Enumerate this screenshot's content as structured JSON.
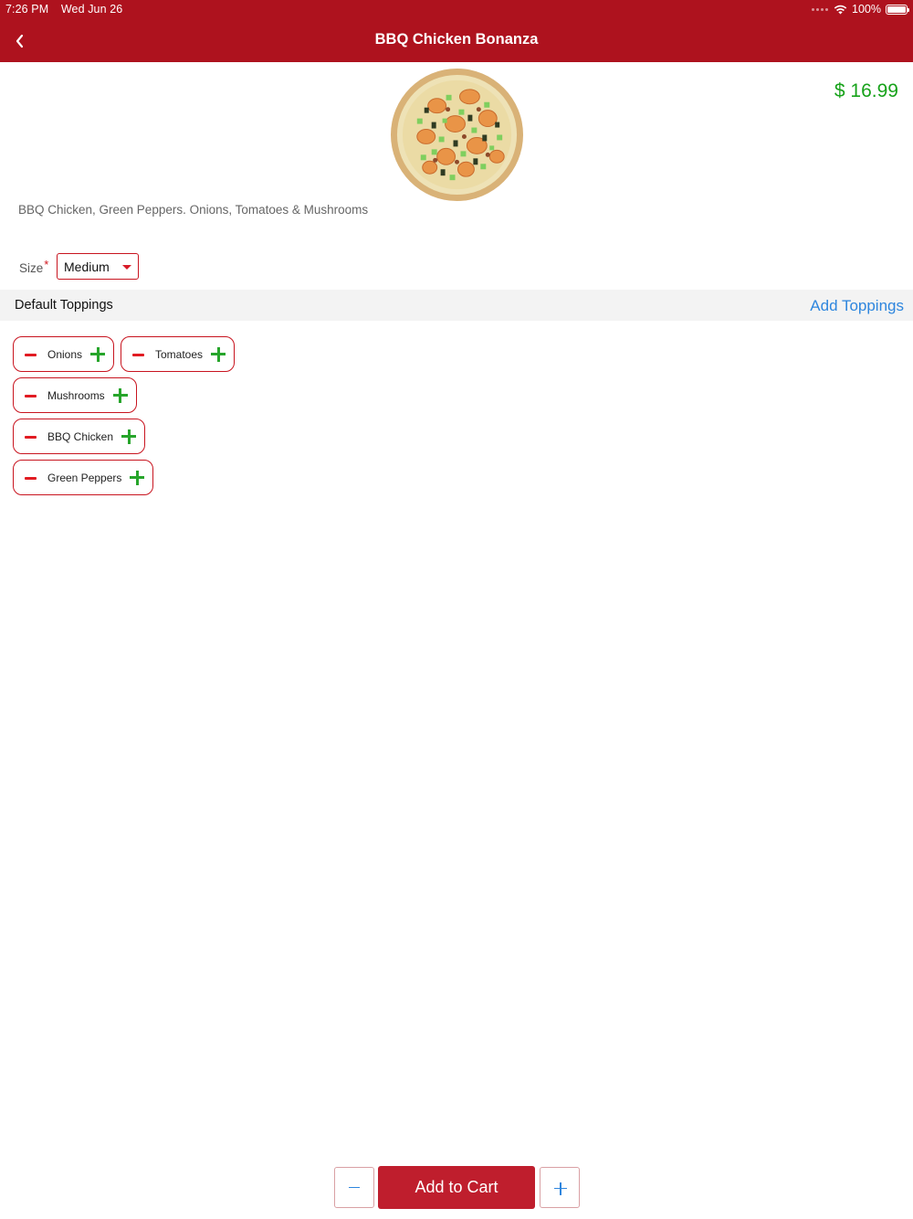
{
  "status_bar": {
    "time": "7:26 PM",
    "date": "Wed Jun 26",
    "battery": "100%",
    "battery_level_percent": 100
  },
  "nav": {
    "title": "BBQ Chicken Bonanza",
    "back_icon": "chevron-left-icon"
  },
  "product": {
    "price": "$ 16.99",
    "description": "BBQ Chicken, Green Peppers. Onions, Tomatoes & Mushrooms",
    "image_icon": "pizza-image"
  },
  "size": {
    "label": "Size",
    "required_marker": "*",
    "selected": "Medium"
  },
  "toppings": {
    "title": "Default Toppings",
    "add_label": "Add Toppings",
    "items": [
      {
        "label": "Onions"
      },
      {
        "label": "Tomatoes"
      },
      {
        "label": "Mushrooms"
      },
      {
        "label": "BBQ Chicken"
      },
      {
        "label": "Green Peppers"
      }
    ]
  },
  "cart": {
    "add_label": "Add to Cart"
  },
  "colors": {
    "header": "#ae121e",
    "price": "#17a21a",
    "link": "#2e86de",
    "minus": "#e11b22",
    "plus": "#27a52b",
    "cart_button": "#bf1e2d"
  }
}
